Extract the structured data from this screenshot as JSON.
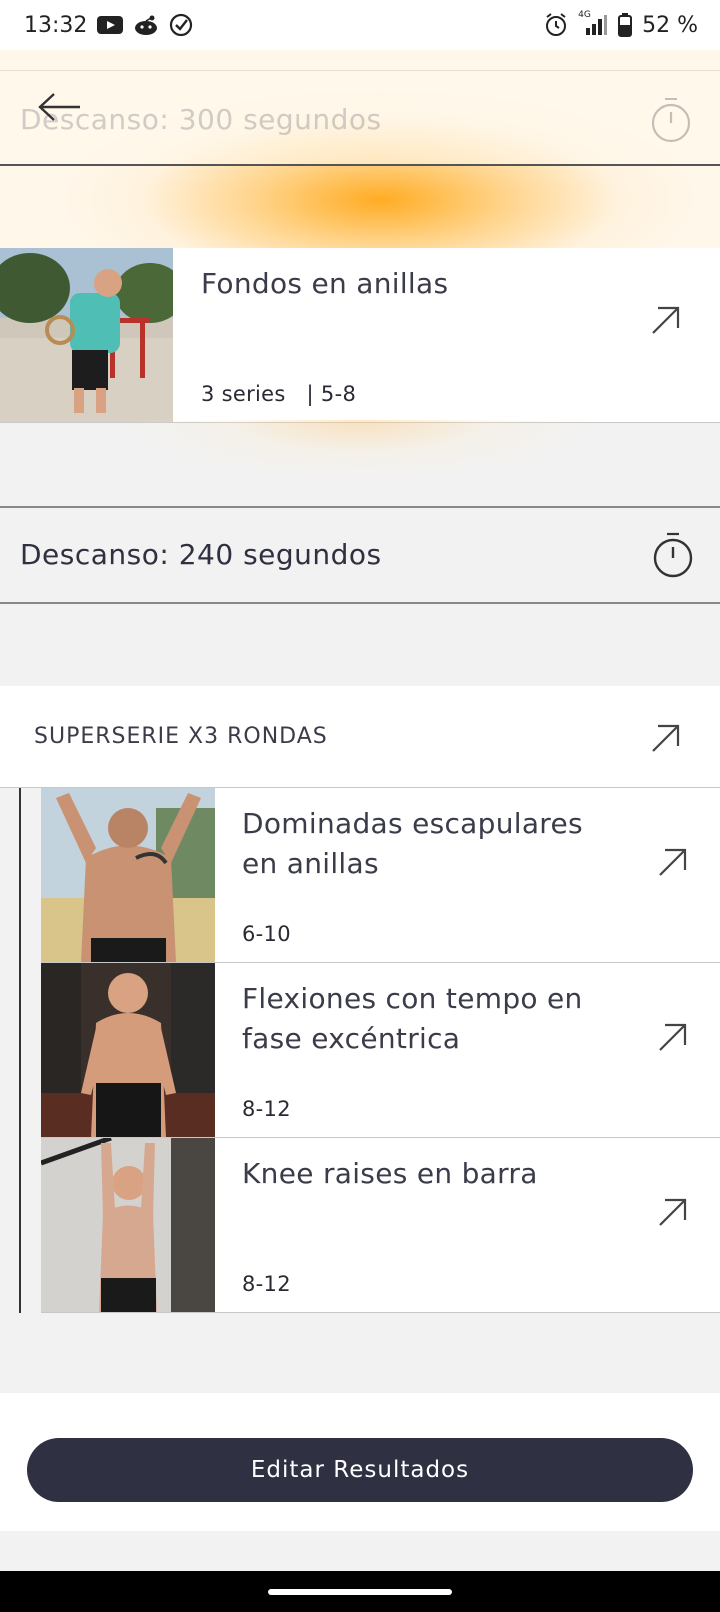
{
  "status_bar": {
    "time": "13:32",
    "network": "4G",
    "battery": "52 %",
    "icons": [
      "youtube-icon",
      "reddit-icon",
      "check-circle-icon",
      "alarm-icon",
      "signal-icon",
      "battery-icon"
    ]
  },
  "header": {
    "rest_label": "Descanso: 300 segundos"
  },
  "exercise_1": {
    "title": "Fondos en anillas",
    "meta": "3 series   | 5-8"
  },
  "rest": {
    "label": "Descanso: 240 segundos"
  },
  "superset": {
    "label": "SUPERSERIE X3 RONDAS",
    "items": [
      {
        "title": "Dominadas escapulares en anillas",
        "reps": "6-10"
      },
      {
        "title": "Flexiones con tempo en fase excéntrica",
        "reps": "8-12"
      },
      {
        "title": "Knee raises en barra",
        "reps": "8-12"
      }
    ]
  },
  "footer": {
    "button_label": "Editar Resultados"
  },
  "colors": {
    "accent_glow": "#ffa818",
    "button_bg": "#2f3142",
    "text_dark": "#2f3040"
  }
}
